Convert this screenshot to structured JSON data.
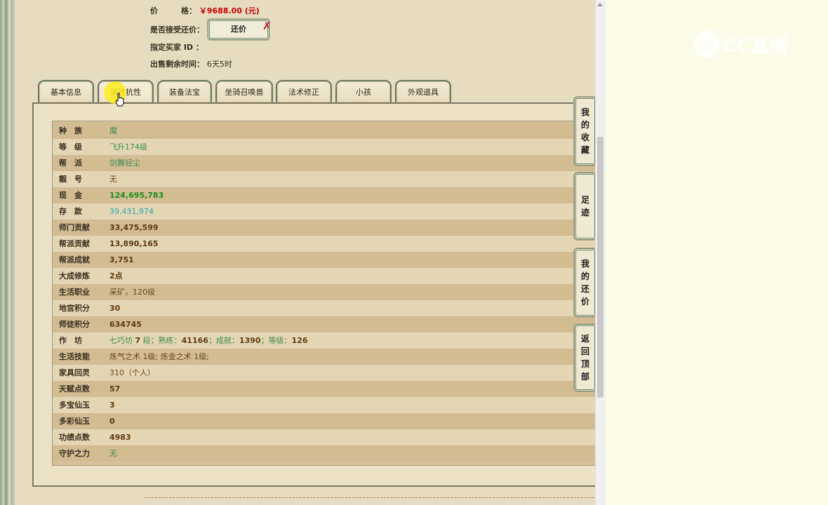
{
  "header": {
    "price_label": "价　　　格：",
    "price_value": "￥9688.00 (元)",
    "counter_label": "是否接受还价：",
    "counter_button": "还价",
    "buyer_label": "指定买家 ID ：",
    "time_label": "出售剩余时间：",
    "time_value": "6天5时"
  },
  "tabs": [
    "基本信息",
    "属性抗性",
    "装备法宝",
    "坐骑召唤兽",
    "法术修正",
    "小孩",
    "外观道具"
  ],
  "rows": [
    {
      "k": "种　族",
      "v": "魔"
    },
    {
      "k": "等　级",
      "v": "飞升174级"
    },
    {
      "k": "帮　派",
      "v": "剑舞轻尘"
    },
    {
      "k": "靓　号",
      "v": "无"
    },
    {
      "k": "现　金",
      "v": "124,695,783"
    },
    {
      "k": "存　款",
      "v": "39,431,974"
    },
    {
      "k": "师门贡献",
      "v": "33,475,599"
    },
    {
      "k": "帮派贡献",
      "v": "13,890,165"
    },
    {
      "k": "帮派成就",
      "v": "3,751"
    },
    {
      "k": "大成修炼",
      "v": "2点"
    },
    {
      "k": "生活职业",
      "v": "采矿，120级"
    },
    {
      "k": "地宫积分",
      "v": "30"
    },
    {
      "k": "师徒积分",
      "v": "634745"
    },
    {
      "k": "作　坊",
      "v": ""
    },
    {
      "k": "生活技能",
      "v": "炼气之术 1级; 炼金之术 1级;"
    },
    {
      "k": "家具回灵",
      "v": "310（个人）"
    },
    {
      "k": "天赋点数",
      "v": "57"
    },
    {
      "k": "多宝仙玉",
      "v": "3"
    },
    {
      "k": "多彩仙玉",
      "v": "0"
    },
    {
      "k": "功绩点数",
      "v": "4983"
    },
    {
      "k": "守护之力",
      "v": "无"
    }
  ],
  "workshop": {
    "p1": "七巧坊 ",
    "n1": "7",
    "p2": " 段；熟练：",
    "n2": "41166",
    "p3": "；成就：",
    "n3": "1390",
    "p4": "；等级：",
    "n4": "126"
  },
  "side": {
    "favorites": [
      "我",
      "的",
      "收",
      "藏"
    ],
    "history": [
      "足",
      "迹"
    ],
    "my_counter": [
      "我",
      "的",
      "还",
      "价"
    ],
    "back_top": [
      "返",
      "回",
      "顶",
      "部"
    ]
  },
  "logo": {
    "text": "CC直播"
  }
}
